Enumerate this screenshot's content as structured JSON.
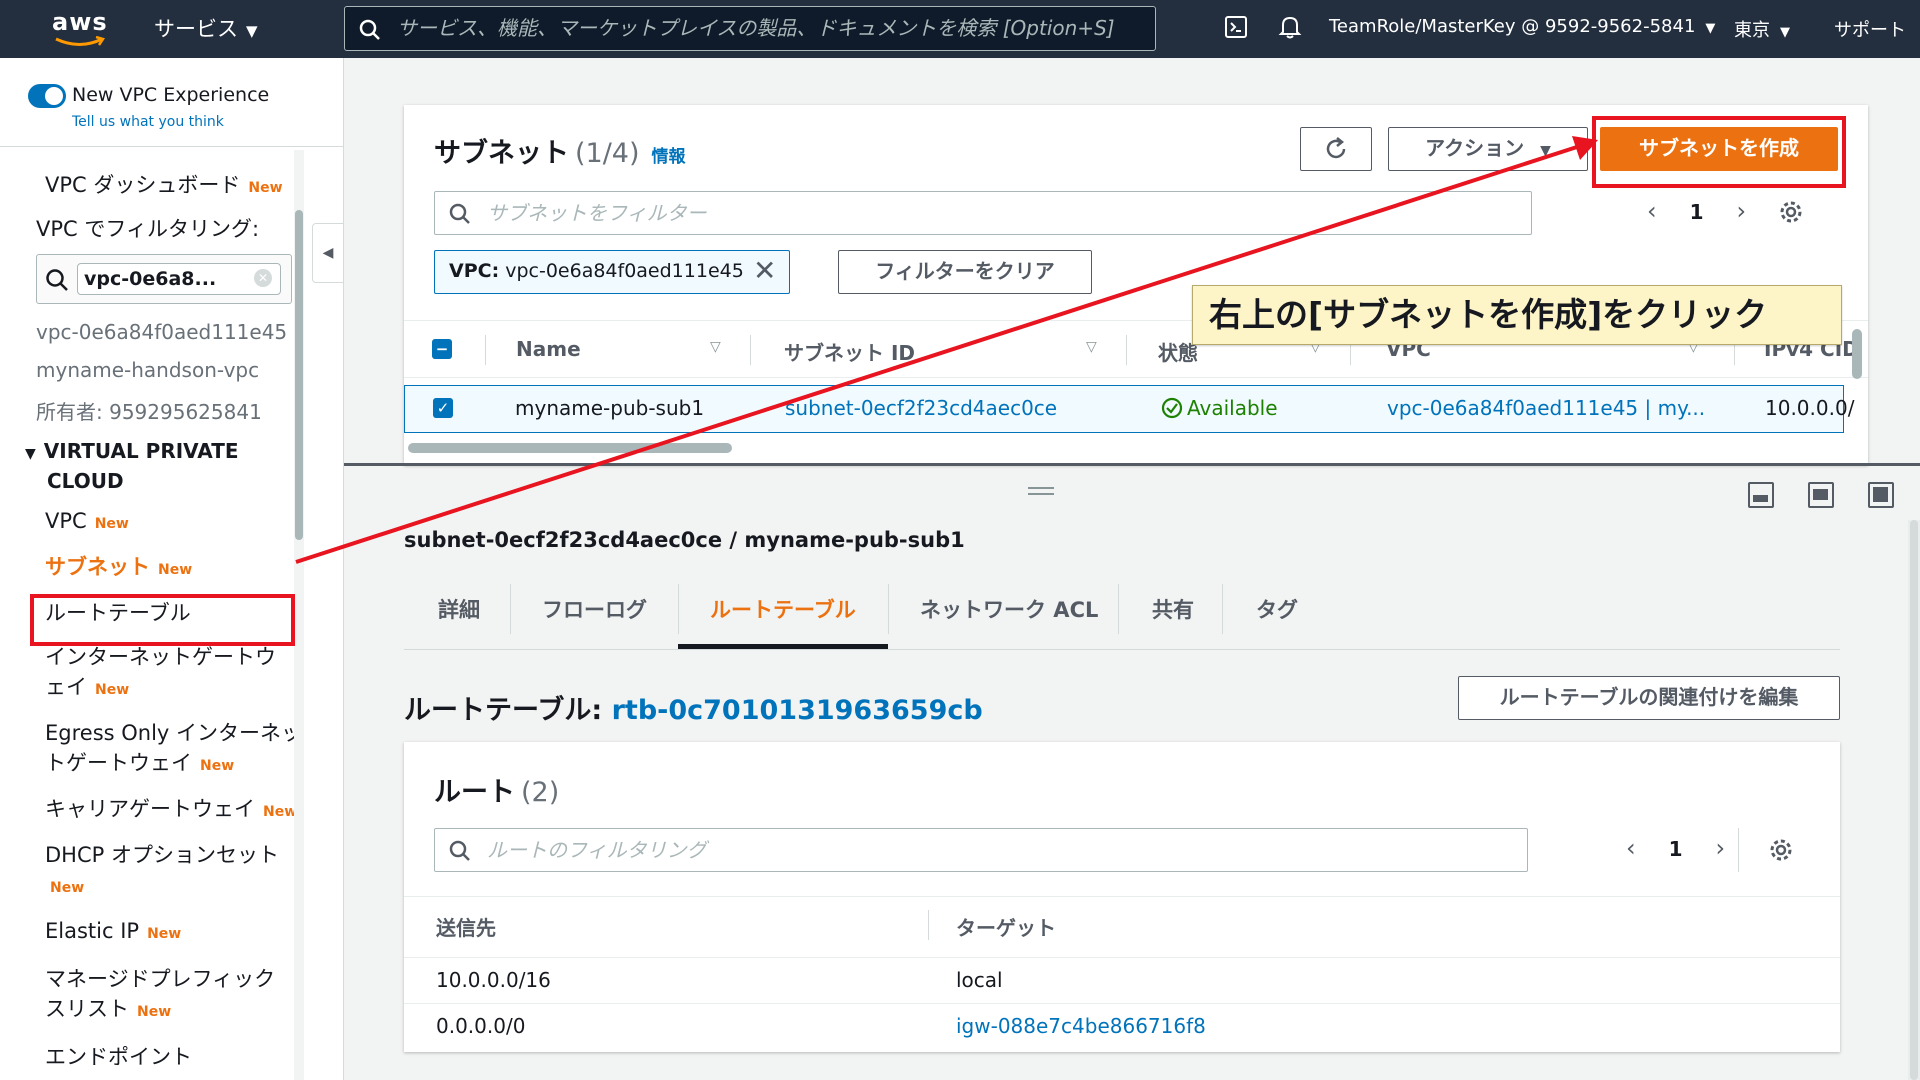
{
  "topnav": {
    "logo_text": "aws",
    "services_label": "サービス",
    "search_placeholder": "サービス、機能、マーケットプレイスの製品、ドキュメントを検索 [Option+S]",
    "account_label": "TeamRole/MasterKey @ 9592-9562-5841",
    "region_label": "東京",
    "support_label": "サポート"
  },
  "sidebar": {
    "toggle_label": "New VPC Experience",
    "feedback_link": "Tell us what you think",
    "dashboard_label": "VPC ダッシュボード",
    "new_badge": "New",
    "filter_heading": "VPC でフィルタリング:",
    "filter_chip": "vpc-0e6a8...",
    "vpc_id": "vpc-0e6a84f0aed111e45",
    "vpc_name": "myname-handson-vpc",
    "owner": "所有者: 959295625841",
    "section_line1": "VIRTUAL PRIVATE",
    "section_line2": "CLOUD",
    "items": [
      {
        "label": "VPC",
        "new": "New"
      },
      {
        "label": "サブネット",
        "new": "New"
      },
      {
        "label": "ルートテーブル",
        "new": ""
      },
      {
        "label": "インターネットゲートウ",
        "label2": "ェイ",
        "new": "New"
      },
      {
        "label": "Egress Only インターネッ",
        "label2": "トゲートウェイ",
        "new": "New"
      },
      {
        "label": "キャリアゲートウェイ",
        "new": "New"
      },
      {
        "label": "DHCP オプションセット",
        "label2": "",
        "new": "New"
      },
      {
        "label": "Elastic IP",
        "new": "New"
      },
      {
        "label": "マネージドプレフィック",
        "label2": "スリスト",
        "new": "New"
      },
      {
        "label": "エンドポイント",
        "new": ""
      }
    ]
  },
  "subnets": {
    "title": "サブネット",
    "count": "(1/4)",
    "info_link": "情報",
    "actions_label": "アクション",
    "create_label": "サブネットを作成",
    "filter_placeholder": "サブネットをフィルター",
    "page_number": "1",
    "token_key": "VPC:",
    "token_value": "vpc-0e6a84f0aed111e45",
    "clear_filters_label": "フィルターをクリア",
    "columns": [
      "Name",
      "サブネット ID",
      "状態",
      "VPC",
      "IPv4 CID"
    ],
    "selected_row": {
      "name": "myname-pub-sub1",
      "subnet_id": "subnet-0ecf2f23cd4aec0ce",
      "state": "Available",
      "vpc": "vpc-0e6a84f0aed111e45 | my...",
      "ipv4": "10.0.0.0/"
    }
  },
  "annotation": {
    "text": "右上の[サブネットを作成]をクリック",
    "color": "#e8141f"
  },
  "detail": {
    "title": "subnet-0ecf2f23cd4aec0ce / myname-pub-sub1",
    "tabs": [
      "詳細",
      "フローログ",
      "ルートテーブル",
      "ネットワーク ACL",
      "共有",
      "タグ"
    ],
    "active_tab": "ルートテーブル",
    "route_table_label": "ルートテーブル:",
    "route_table_id": "rtb-0c7010131963659cb",
    "edit_assoc_label": "ルートテーブルの関連付けを編集",
    "routes_title": "ルート",
    "routes_count": "(2)",
    "routes_filter_placeholder": "ルートのフィルタリング",
    "routes_page": "1",
    "routes_columns": [
      "送信先",
      "ターゲット"
    ],
    "routes": [
      {
        "destination": "10.0.0.0/16",
        "target": "local"
      },
      {
        "destination": "0.0.0.0/0",
        "target": "igw-088e7c4be866716f8"
      }
    ]
  },
  "colors": {
    "nav_bg": "#232f3e",
    "accent_orange": "#ec7211",
    "link_blue": "#0073bb",
    "success_green": "#1d8102",
    "highlight_red": "#e8141f"
  }
}
